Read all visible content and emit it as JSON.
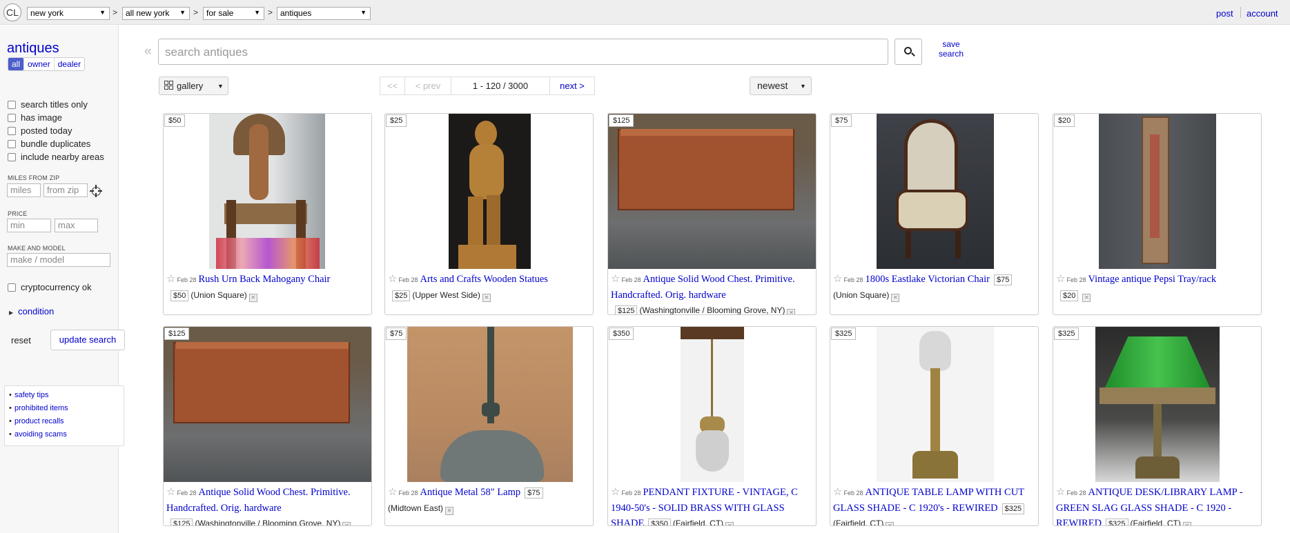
{
  "topbar": {
    "logo": "CL",
    "crumbs": [
      "new york",
      "all new york",
      "for sale",
      "antiques"
    ],
    "separator": ">",
    "post": "post",
    "account": "account"
  },
  "sidebar": {
    "category": "antiques",
    "seller_types": [
      "all",
      "owner",
      "dealer"
    ],
    "checkboxes": [
      "search titles only",
      "has image",
      "posted today",
      "bundle duplicates",
      "include nearby areas"
    ],
    "miles_label": "MILES FROM ZIP",
    "miles_placeholder": "miles",
    "zip_placeholder": "from zip",
    "price_label": "PRICE",
    "min_placeholder": "min",
    "max_placeholder": "max",
    "make_label": "MAKE AND MODEL",
    "make_placeholder": "make / model",
    "crypto": "cryptocurrency ok",
    "condition": "condition",
    "reset": "reset",
    "update": "update search",
    "help_links": [
      "safety tips",
      "prohibited items",
      "product recalls",
      "avoiding scams"
    ]
  },
  "search": {
    "placeholder": "search antiques",
    "save_line1": "save",
    "save_line2": "search"
  },
  "toolbar": {
    "view": "gallery",
    "first": "<<",
    "prev": "< prev",
    "range": "1 - 120 / 3000",
    "next": "next >",
    "sort": "newest"
  },
  "listings": [
    {
      "price": "$50",
      "date": "Feb 28",
      "title": "Rush Urn Back Mahogany Chair",
      "badge": "$50",
      "hood": "(Union Square)"
    },
    {
      "price": "$25",
      "date": "Feb 28",
      "title": "Arts and Crafts Wooden Statues",
      "badge": "$25",
      "hood": "(Upper West Side)"
    },
    {
      "price": "$125",
      "date": "Feb 28",
      "title": "Antique Solid Wood Chest. Primitive. Handcrafted. Orig. hardware",
      "badge": "$125",
      "hood": "(Washingtonville / Blooming Grove, NY)"
    },
    {
      "price": "$75",
      "date": "Feb 28",
      "title": "1800s Eastlake Victorian Chair",
      "badge": "$75",
      "hood": "(Union Square)"
    },
    {
      "price": "$20",
      "date": "Feb 28",
      "title": "Vintage antique Pepsi Tray/rack",
      "badge": "$20",
      "hood": ""
    },
    {
      "price": "$125",
      "date": "Feb 28",
      "title": "Antique Solid Wood Chest. Primitive. Handcrafted. Orig. hardware",
      "badge": "$125",
      "hood": "(Washingtonville / Blooming Grove, NY)"
    },
    {
      "price": "$75",
      "date": "Feb 28",
      "title": "Antique Metal 58\" Lamp",
      "badge": "$75",
      "hood": "(Midtown East)"
    },
    {
      "price": "$350",
      "date": "Feb 28",
      "title": "PENDANT FIXTURE - VINTAGE, C 1940-50's - SOLID BRASS WITH GLASS SHADE",
      "badge": "$350",
      "hood": "(Fairfield, CT)"
    },
    {
      "price": "$325",
      "date": "Feb 28",
      "title": "ANTIQUE TABLE LAMP WITH CUT GLASS SHADE - C 1920's - REWIRED",
      "badge": "$325",
      "hood": "(Fairfield, CT)"
    },
    {
      "price": "$325",
      "date": "Feb 28",
      "title": "ANTIQUE DESK/LIBRARY LAMP -GREEN SLAG GLASS SHADE - C 1920 - REWIRED",
      "badge": "$325",
      "hood": "(Fairfield, CT)"
    }
  ]
}
